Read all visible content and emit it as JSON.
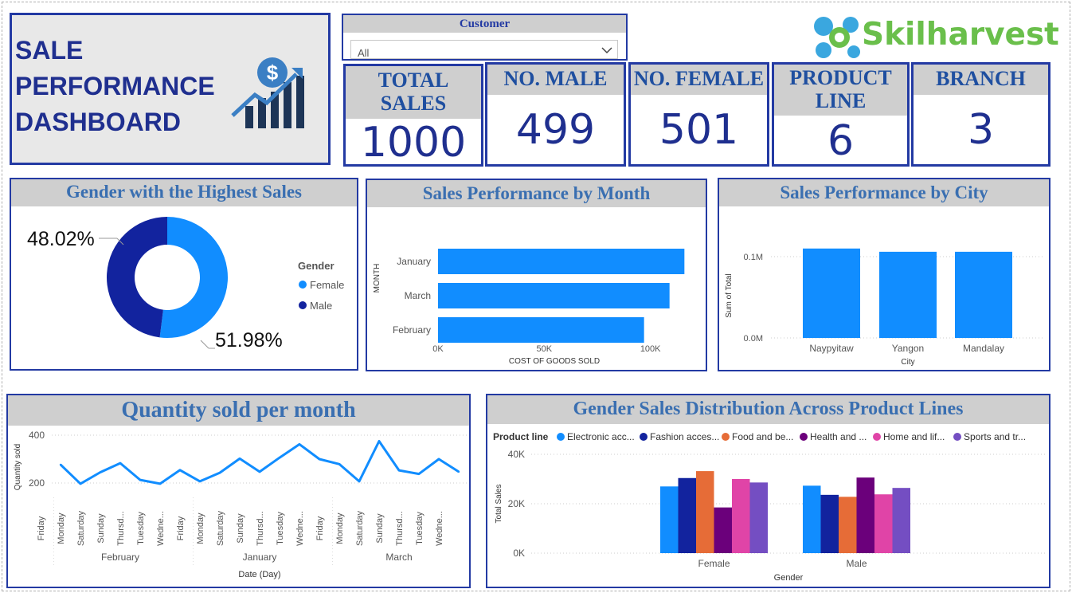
{
  "title_card": {
    "line1": "SALE",
    "line2": "PERFORMANCE",
    "line3": "DASHBOARD"
  },
  "slicer": {
    "label": "Customer",
    "value": "All"
  },
  "logo": {
    "text": "Skilharvest"
  },
  "kpis": {
    "total_sales": {
      "label1": "TOTAL",
      "label2": "SALES",
      "value": "1000"
    },
    "no_male": {
      "label": "NO. MALE",
      "value": "499"
    },
    "no_female": {
      "label": "NO. FEMALE",
      "value": "501"
    },
    "product_line": {
      "label1": "PRODUCT",
      "label2": "LINE",
      "value": "6"
    },
    "branch": {
      "label": "BRANCH",
      "value": "3"
    }
  },
  "colors": {
    "navy": "#233aa3",
    "blue": "#118dff",
    "dark_navy": "#12239e",
    "orange": "#e66c37",
    "purple": "#6b007b",
    "pink": "#e044a7",
    "violet": "#744ec2",
    "header_gray": "#cfcfcf",
    "header_text": "#3a6fb1"
  },
  "chart_data": [
    {
      "type": "pie",
      "title": "Gender with the Highest Sales",
      "legend_title": "Gender",
      "categories": [
        "Female",
        "Male"
      ],
      "values": [
        51.98,
        48.02
      ],
      "labels": [
        "51.98%",
        "48.02%"
      ],
      "legend": "right"
    },
    {
      "type": "bar",
      "title": "Sales Performance by Month",
      "orientation": "horizontal",
      "categories": [
        "January",
        "March",
        "February"
      ],
      "values": [
        116000,
        109000,
        97000
      ],
      "xlabel": "COST OF GOODS SOLD",
      "ylabel": "MONTH",
      "xticks": [
        "0K",
        "50K",
        "100K"
      ],
      "xlim": [
        0,
        120000
      ]
    },
    {
      "type": "bar",
      "title": "Sales Performance by City",
      "categories": [
        "Naypyitaw",
        "Yangon",
        "Mandalay"
      ],
      "values": [
        110000,
        106000,
        106000
      ],
      "xlabel": "City",
      "ylabel": "Sum of Total",
      "yticks": [
        "0.0M",
        "0.1M"
      ],
      "ylim": [
        0,
        120000
      ]
    },
    {
      "type": "line",
      "title": "Quantity sold per month",
      "xlabel": "Date (Day)",
      "ylabel": "Quantity sold",
      "months": [
        "February",
        "January",
        "March"
      ],
      "x": [
        "Friday",
        "Monday",
        "Saturday",
        "Sunday",
        "Thursd...",
        "Tuesday",
        "Wedne...",
        "Friday",
        "Monday",
        "Saturday",
        "Sunday",
        "Thursd...",
        "Tuesday",
        "Wedne...",
        "Friday",
        "Monday",
        "Saturday",
        "Sunday",
        "Thursd...",
        "Tuesday",
        "Wedne..."
      ],
      "values": [
        277,
        197,
        245,
        283,
        213,
        197,
        254,
        207,
        243,
        302,
        247,
        306,
        362,
        300,
        279,
        207,
        375,
        253,
        238,
        300,
        247
      ],
      "yticks": [
        "200",
        "400"
      ],
      "ylim": [
        100,
        420
      ]
    },
    {
      "type": "bar",
      "title": "Gender Sales Distribution Across Product Lines",
      "legend_title": "Product line",
      "categories": [
        "Female",
        "Male"
      ],
      "series": [
        {
          "name": "Electronic acc...",
          "values": [
            27000,
            27300
          ]
        },
        {
          "name": "Fashion acces...",
          "values": [
            30400,
            23600
          ]
        },
        {
          "name": "Food and be...",
          "values": [
            33200,
            22800
          ]
        },
        {
          "name": "Health and ...",
          "values": [
            18500,
            30600
          ]
        },
        {
          "name": "Home and lif...",
          "values": [
            30000,
            23800
          ]
        },
        {
          "name": "Sports and tr...",
          "values": [
            28600,
            26400
          ]
        }
      ],
      "xlabel": "Gender",
      "ylabel": "Total Sales",
      "yticks": [
        "0K",
        "20K",
        "40K"
      ],
      "ylim": [
        0,
        40000
      ],
      "legend": "top"
    }
  ]
}
